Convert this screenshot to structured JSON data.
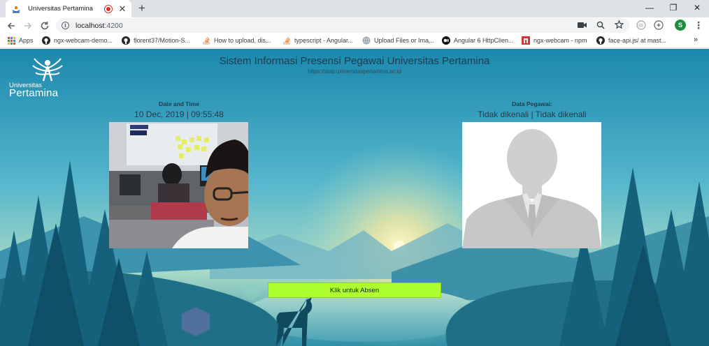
{
  "browser": {
    "tab": {
      "title": "Universitas Pertamina"
    },
    "newtab_label": "+",
    "window_controls": {
      "minimize": "—",
      "restore": "❐",
      "close": "✕"
    },
    "address": {
      "host": "localhost",
      "port": ":4200"
    },
    "profile_initial": "S",
    "bookmarks": [
      {
        "label": "Apps",
        "icon": "apps-grid-icon"
      },
      {
        "label": "ngx-webcam-demo...",
        "icon": "github-icon"
      },
      {
        "label": "florent37/Motion-S...",
        "icon": "github-icon"
      },
      {
        "label": "How to upload, dis...",
        "icon": "stackoverflow-icon"
      },
      {
        "label": "typescript - Angular...",
        "icon": "stackoverflow-icon"
      },
      {
        "label": "Upload Files or Ima...",
        "icon": "globe-icon"
      },
      {
        "label": "Angular 6 HttpClien...",
        "icon": "medium-icon"
      },
      {
        "label": "ngx-webcam - npm",
        "icon": "npm-icon"
      },
      {
        "label": "face-api.js/ at mast...",
        "icon": "github-icon"
      }
    ],
    "bookmarks_more": "»"
  },
  "page": {
    "logo": {
      "small": "Universitas",
      "big": "Pertamina"
    },
    "title": "Sistem Informasi Presensi Pegawai Universitas Pertamina",
    "url": "https://siap.universitaspertamina.ac.id",
    "datetime": {
      "label": "Date and Time",
      "value": "10 Dec, 2019 | 09:55:48"
    },
    "employee": {
      "label": "Data Pegawai:",
      "value": "Tidak dikenali | Tidak dikenali"
    },
    "absen_button": "Klik untuk Absen"
  },
  "colors": {
    "sky_top": "#1f8fb0",
    "sky_bottom": "#7cc9d6",
    "button_green": "#adff2f",
    "title_text": "#1f3b4d"
  }
}
